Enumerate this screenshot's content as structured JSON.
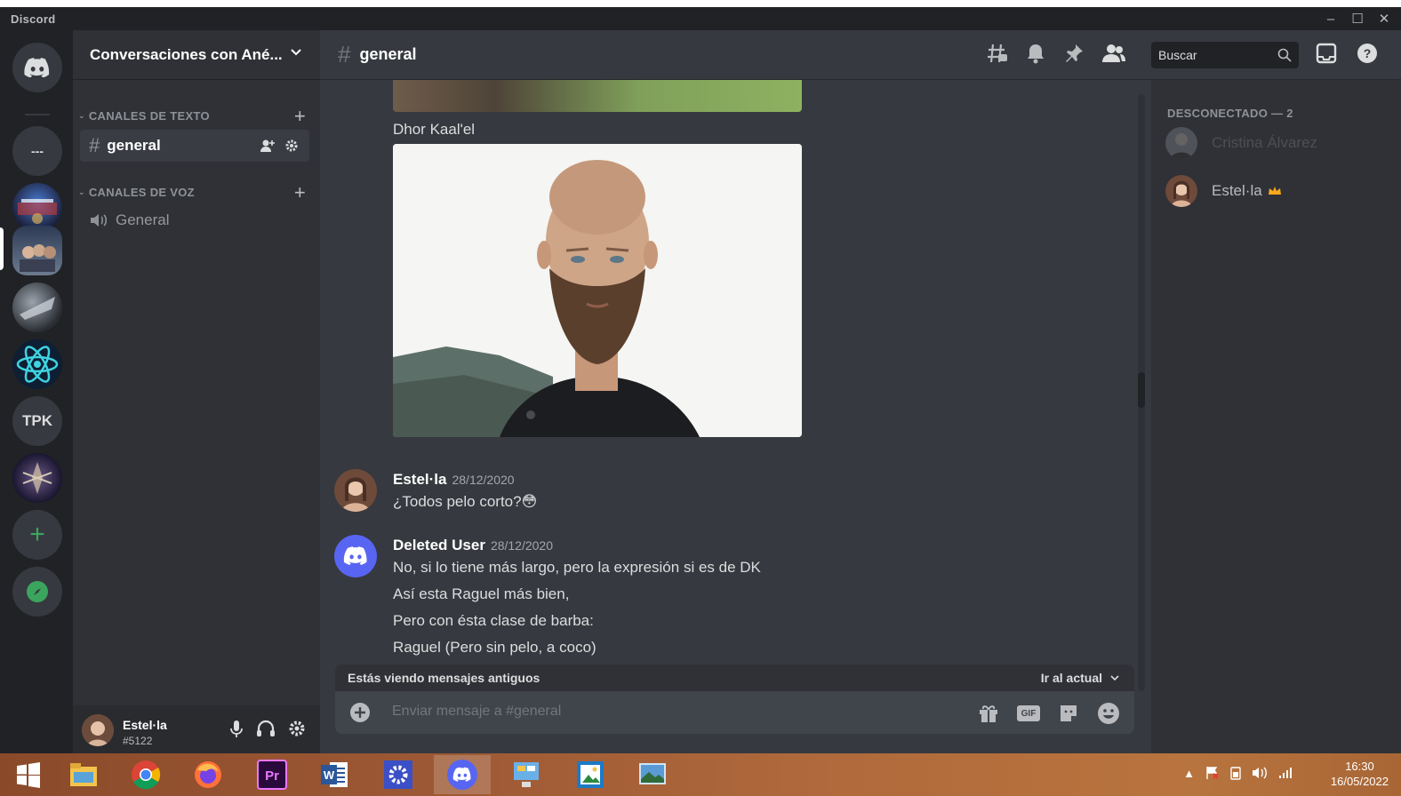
{
  "window": {
    "app_title": "Discord",
    "controls": [
      "minimize",
      "maximize",
      "close"
    ]
  },
  "servers": [
    {
      "name": "home",
      "icon": "discord-logo-icon"
    },
    {
      "name": "dm-folder",
      "label": "---"
    },
    {
      "name": "server-1"
    },
    {
      "name": "server-2-selected"
    },
    {
      "name": "server-3"
    },
    {
      "name": "server-atom"
    },
    {
      "name": "server-tpk",
      "label": "TPK"
    },
    {
      "name": "server-dragon"
    },
    {
      "name": "add-server",
      "label": "+"
    },
    {
      "name": "explore",
      "icon": "compass-icon"
    }
  ],
  "guild": {
    "name": "Conversaciones con Ané..."
  },
  "categories": {
    "text": "CANALES DE TEXTO",
    "voice": "CANALES DE VOZ"
  },
  "channels": {
    "text": [
      {
        "name": "general",
        "active": true
      }
    ],
    "voice": [
      {
        "name": "General"
      }
    ]
  },
  "user": {
    "name": "Estel·la",
    "tag": "#5122"
  },
  "chat": {
    "channel_name": "general",
    "search_placeholder": "Buscar",
    "image_caption": "Dhor Kaal'el",
    "messages": [
      {
        "author": "Estel·la",
        "time": "28/12/2020",
        "lines": [
          "¿Todos pelo corto?😳"
        ]
      },
      {
        "author": "Deleted User",
        "time": "28/12/2020",
        "lines": [
          "No,  si lo tiene  más largo, pero  la expresión si es de DK",
          "Así esta Raguel más bien,",
          "Pero con ésta clase de barba:",
          "Raguel  (Pero sin pelo, a coco)"
        ]
      }
    ],
    "old_messages_notice": "Estás viendo mensajes antiguos",
    "jump_label": "Ir al actual",
    "composer_placeholder": "Enviar mensaje a #general",
    "gif_label": "GIF"
  },
  "members": {
    "section_title": "DESCONECTADO — 2",
    "list": [
      {
        "name": "Cristina Álvarez",
        "offline": true
      },
      {
        "name": "Estel·la",
        "owner": true
      }
    ]
  },
  "taskbar": {
    "apps": [
      "start",
      "file-explorer",
      "chrome",
      "firefox",
      "premiere",
      "word",
      "settings",
      "discord",
      "remote-desktop",
      "photos",
      "photo-viewer"
    ],
    "active": "discord",
    "time": "16:30",
    "date": "16/05/2022"
  },
  "colors": {
    "blurple": "#5865f2",
    "green": "#3ba55d",
    "crown": "#faa81a"
  }
}
